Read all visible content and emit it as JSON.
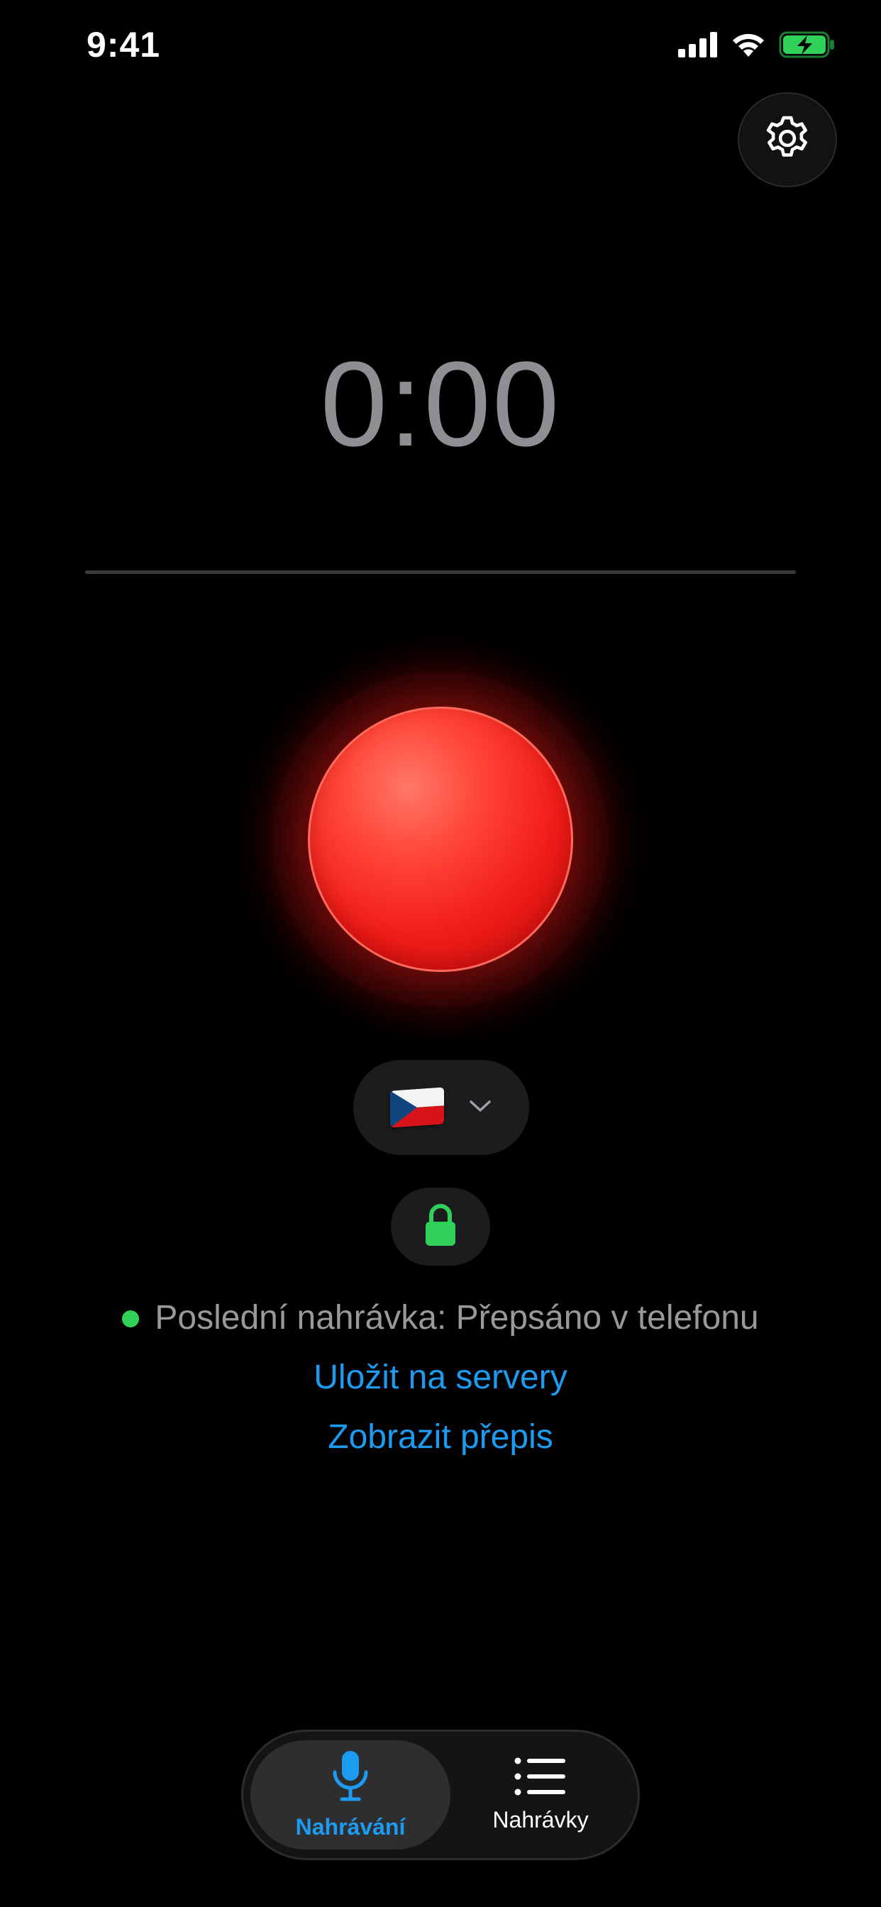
{
  "status_bar": {
    "time": "9:41",
    "icons": [
      "cellular-signal-icon",
      "wifi-icon",
      "battery-charging-icon"
    ]
  },
  "header": {
    "settings_icon": "gear-icon"
  },
  "recorder": {
    "timer": "0:00",
    "record_button_color": "#f01c17"
  },
  "language": {
    "selected": "🇨🇿",
    "chevron_icon": "chevron-down-icon"
  },
  "lock": {
    "icon": "lock-icon",
    "color": "#30d158"
  },
  "status": {
    "indicator_color": "#30d158",
    "last_recording_text": "Poslední nahrávka: Přepsáno v telefonu",
    "save_link": "Uložit na servery",
    "transcript_link": "Zobrazit přepis"
  },
  "tab_bar": {
    "tabs": [
      {
        "label": "Nahrávání",
        "icon": "microphone-icon",
        "active": true
      },
      {
        "label": "Nahrávky",
        "icon": "list-icon",
        "active": false
      }
    ],
    "accent_color": "#1d9bf0"
  }
}
